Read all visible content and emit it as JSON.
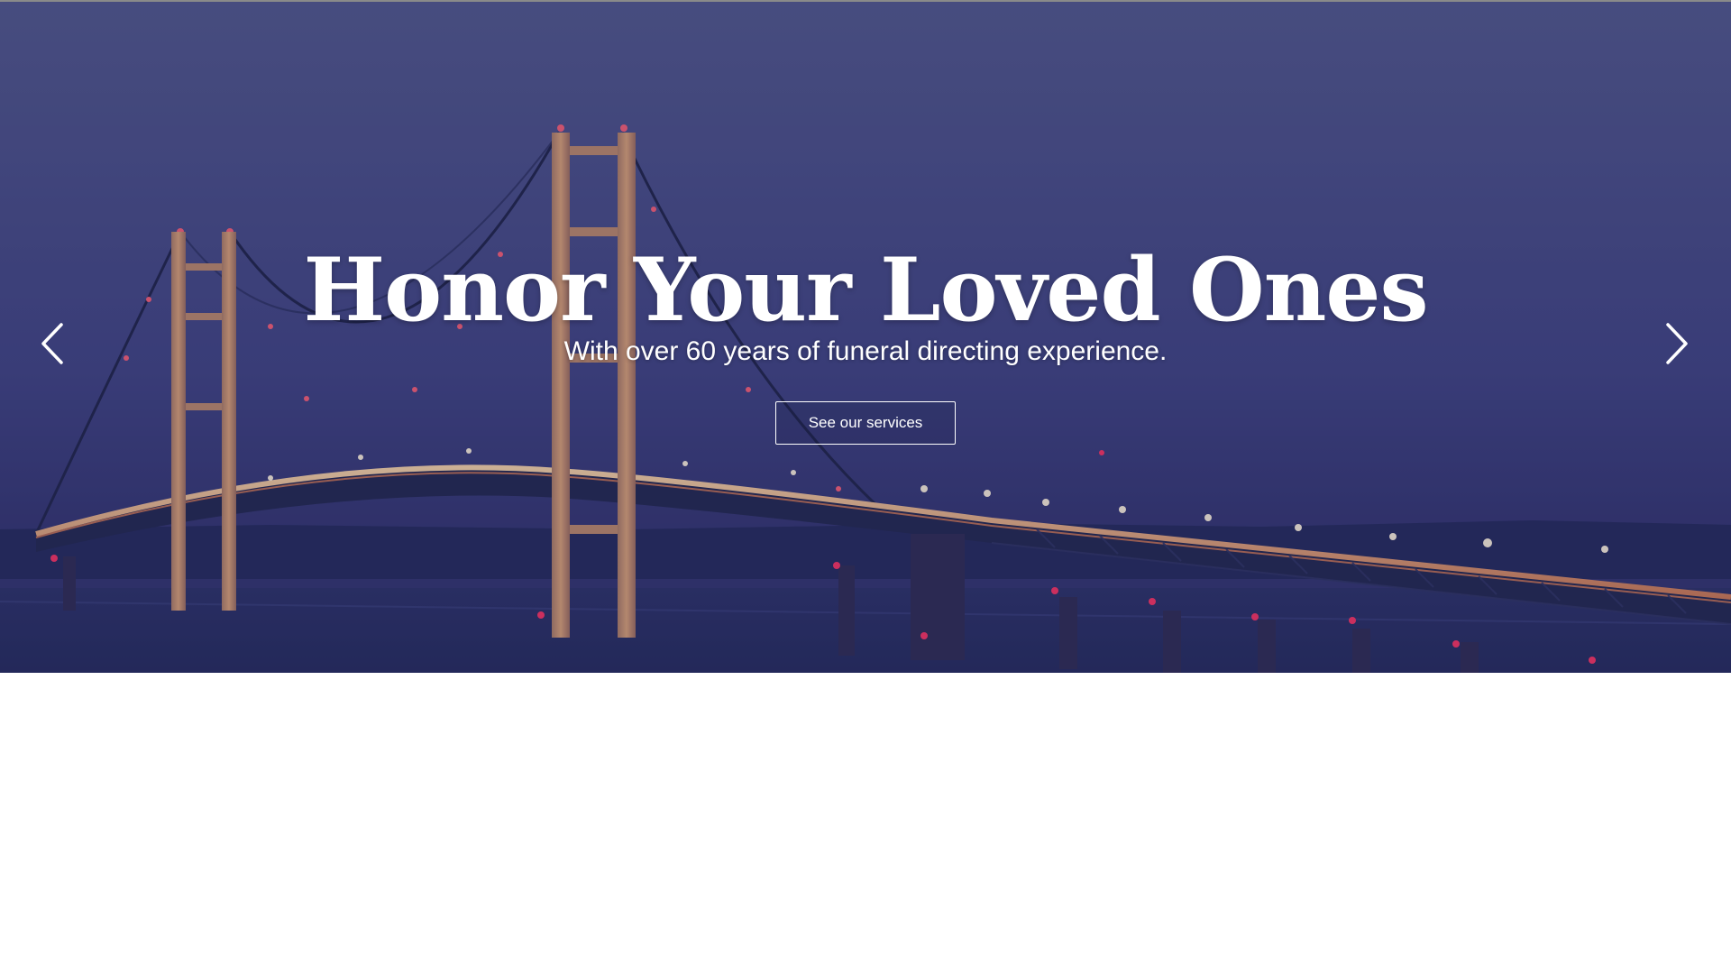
{
  "hero": {
    "title": "Honor Your Loved Ones",
    "subtitle": "With over 60 years of funeral directing experience.",
    "cta_label": "See our services",
    "background_image": "suspension-bridge-at-night",
    "overlay_color": "#3c3f78"
  },
  "carousel": {
    "prev_icon": "chevron-left-icon",
    "next_icon": "chevron-right-icon"
  }
}
